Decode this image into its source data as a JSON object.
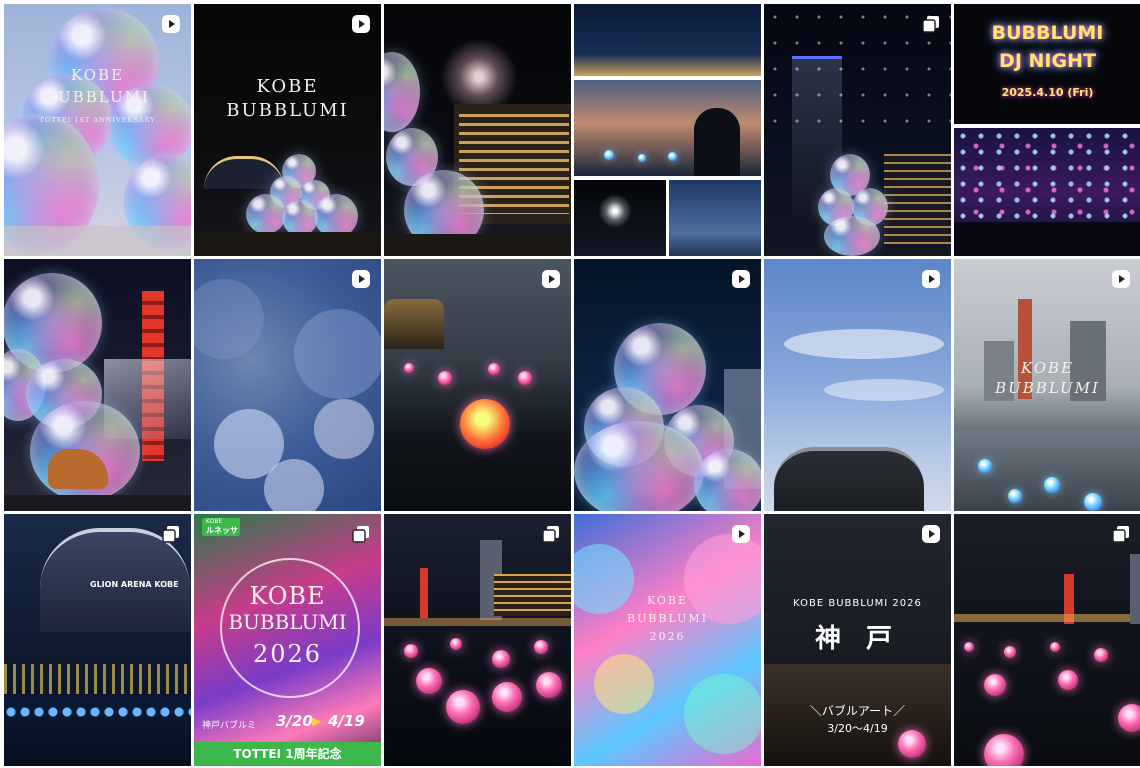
{
  "grid": {
    "tiles": [
      {
        "title_line1": "KOBE",
        "title_line2": "BUBBLUMI",
        "subtitle": "TOTTEI 1ST ANNIVERSARY",
        "badge_icon": "reel-icon"
      },
      {
        "title_line1": "KOBE",
        "title_line2": "BUBBLUMI",
        "badge_icon": "reel-icon"
      },
      {
        "badge_icon": ""
      },
      {
        "badge_icon": ""
      },
      {
        "badge_icon": "carousel-icon"
      },
      {
        "sign_line1": "BUBBLUMI",
        "sign_line2": "DJ NIGHT",
        "sign_date": "2025.4.10 (Fri)"
      },
      {
        "badge_icon": ""
      },
      {
        "badge_icon": "reel-icon"
      },
      {
        "badge_icon": "reel-icon"
      },
      {
        "badge_icon": "reel-icon"
      },
      {
        "badge_icon": "reel-icon"
      },
      {
        "title_line1": "KOBE",
        "title_line2": "BUBBLUMI",
        "badge_icon": "reel-icon"
      },
      {
        "sign_text": "GLION ARENA KOBE",
        "badge_icon": "carousel-icon"
      },
      {
        "tag_line1": "KOBE",
        "tag_line2": "ルネッサ",
        "title_line1": "KOBE",
        "title_line2": "BUBBLUMI",
        "year": "2026",
        "date_label": "神戸バブルミ",
        "date_start": "3/20",
        "date_end": "4/19",
        "banner": "TOTTEI 1周年記念",
        "badge_icon": "carousel-icon"
      },
      {
        "badge_icon": "carousel-icon"
      },
      {
        "title_line1": "KOBE",
        "title_line2": "BUBBLUMI",
        "year": "2026",
        "badge_icon": "reel-icon"
      },
      {
        "heading": "KOBE BUBBLUMI 2026",
        "kanji": "神 戸",
        "line1": "＼バブルアート／",
        "line2": "3/20〜4/19",
        "badge_icon": "reel-icon"
      },
      {
        "badge_icon": "carousel-icon"
      }
    ]
  },
  "colors": {
    "reel_badge": "#ffffff",
    "banner_green": "#3cb84a"
  }
}
